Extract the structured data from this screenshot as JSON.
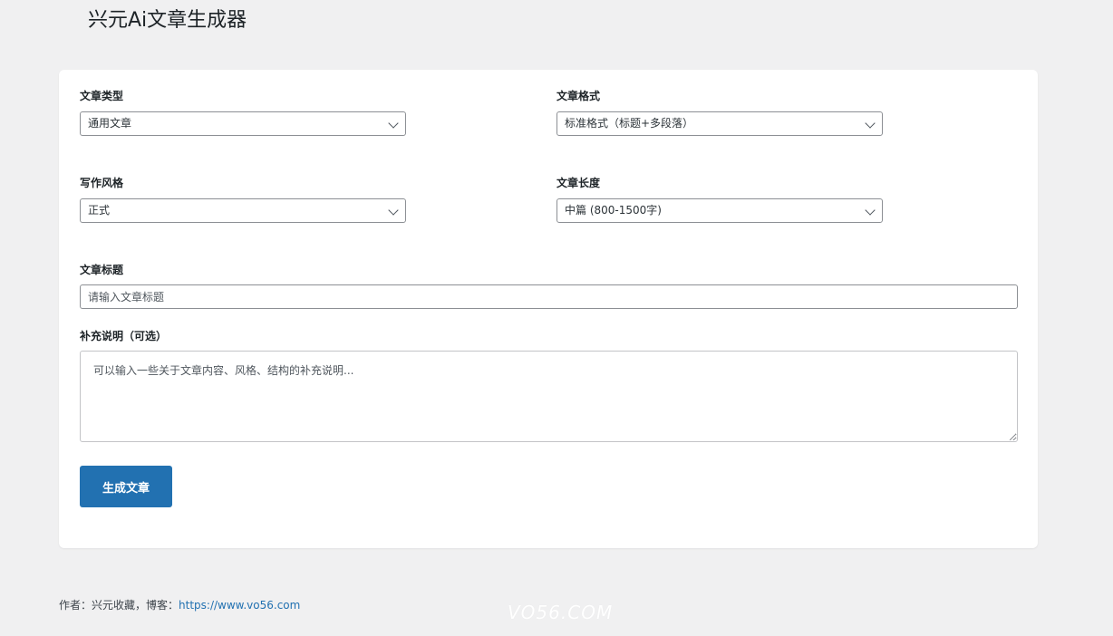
{
  "page": {
    "title": "兴元Ai文章生成器"
  },
  "form": {
    "article_type": {
      "label": "文章类型",
      "selected": "通用文章"
    },
    "article_format": {
      "label": "文章格式",
      "selected": "标准格式（标题+多段落）"
    },
    "writing_style": {
      "label": "写作风格",
      "selected": "正式"
    },
    "article_length": {
      "label": "文章长度",
      "selected": "中篇 (800-1500字)"
    },
    "article_title": {
      "label": "文章标题",
      "value": "",
      "placeholder": "请输入文章标题"
    },
    "extra_notes": {
      "label": "补充说明（可选）",
      "value": "",
      "placeholder": "可以输入一些关于文章内容、风格、结构的补充说明..."
    },
    "submit_label": "生成文章"
  },
  "footer": {
    "prefix": "作者：兴元收藏，博客：",
    "link_text": "https://www.vo56.com"
  },
  "watermark": {
    "text": "VO56.COM"
  },
  "colors": {
    "accent": "#2271b1",
    "background": "#f0f0f1",
    "card": "#ffffff"
  },
  "icons": {
    "select_arrow": "chevron-down-icon"
  }
}
